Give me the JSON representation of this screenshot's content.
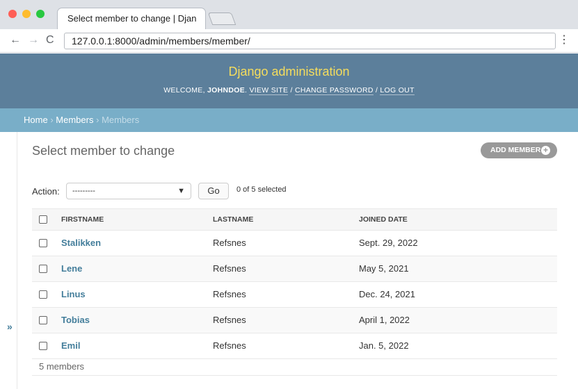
{
  "browser": {
    "tab_title": "Select member to change | Djan",
    "url": "127.0.0.1:8000/admin/members/member/",
    "traffic_light_colors": [
      "#ff5f57",
      "#febc2e",
      "#28c840"
    ]
  },
  "header": {
    "branding": "Django administration",
    "welcome": "Welcome,",
    "username": "johndoe",
    "view_site": "View site",
    "change_password": "Change password",
    "log_out": "Log out"
  },
  "breadcrumbs": {
    "home": "Home",
    "sep": "›",
    "app": "Members",
    "current": "Members"
  },
  "page": {
    "title": "Select member to change",
    "add_button": "Add member",
    "sidebar_toggle": "»"
  },
  "actions": {
    "label": "Action:",
    "selected": "---------",
    "go": "Go",
    "counter": "0 of 5 selected"
  },
  "table": {
    "columns": [
      "Firstname",
      "Lastname",
      "Joined date"
    ],
    "rows": [
      {
        "firstname": "Stalikken",
        "lastname": "Refsnes",
        "joined": "Sept. 29, 2022"
      },
      {
        "firstname": "Lene",
        "lastname": "Refsnes",
        "joined": "May 5, 2021"
      },
      {
        "firstname": "Linus",
        "lastname": "Refsnes",
        "joined": "Dec. 24, 2021"
      },
      {
        "firstname": "Tobias",
        "lastname": "Refsnes",
        "joined": "April 1, 2022"
      },
      {
        "firstname": "Emil",
        "lastname": "Refsnes",
        "joined": "Jan. 5, 2022"
      }
    ],
    "paginator": "5 members"
  },
  "colors": {
    "header_bg": "#5c7f9b",
    "branding": "#f5dd5d",
    "breadcrumbs_bg": "#79aec8",
    "link": "#447e9b"
  }
}
